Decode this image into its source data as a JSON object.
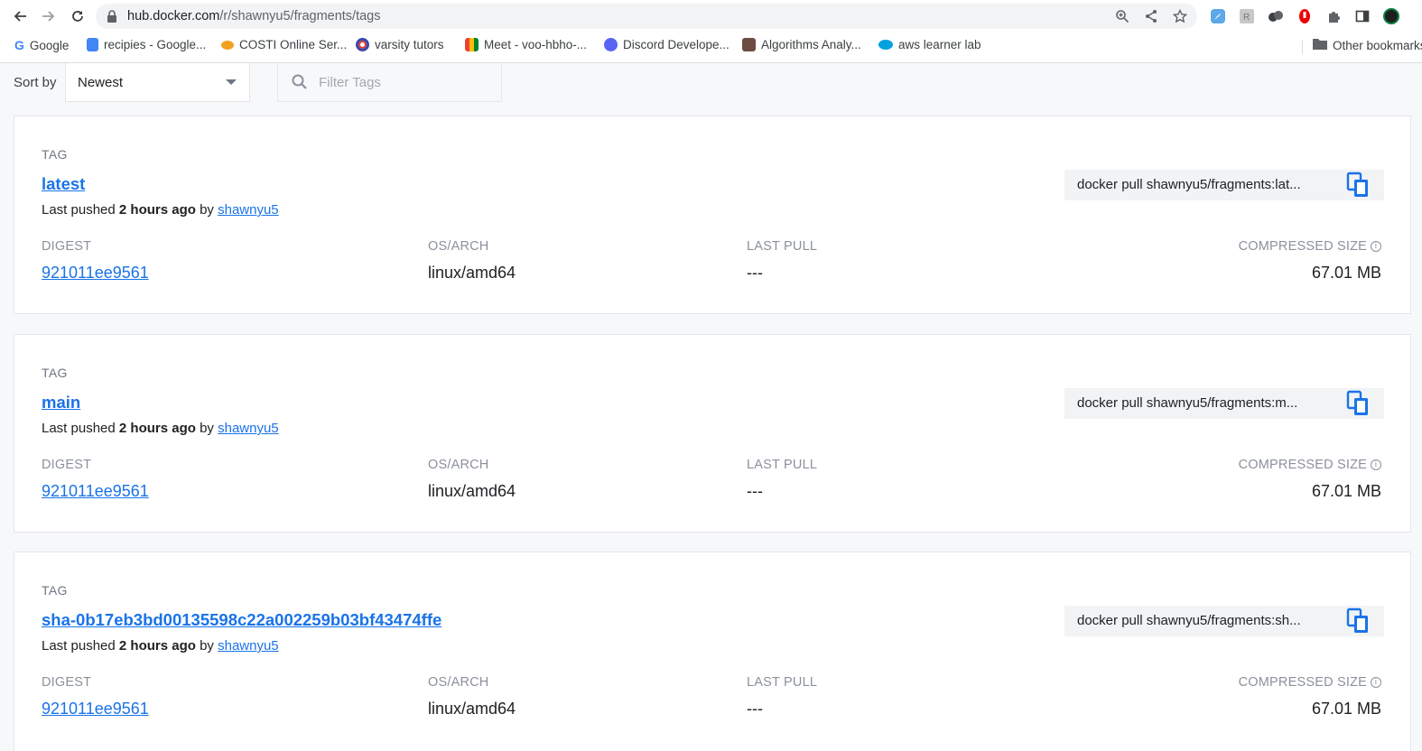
{
  "browser": {
    "url_host": "hub.docker.com",
    "url_path": "/r/shawnyu5/fragments/tags",
    "bookmarks": [
      {
        "label": "Google",
        "color": "#4285f4"
      },
      {
        "label": "recipies - Google...",
        "color": "#4285f4"
      },
      {
        "label": "COSTI Online Ser...",
        "color": "#f4a020"
      },
      {
        "label": "varsity tutors",
        "color": "#e53935"
      },
      {
        "label": "Meet - voo-hbho-...",
        "color": "#00832d"
      },
      {
        "label": "Discord Develope...",
        "color": "#5865f2"
      },
      {
        "label": "Algorithms Analy...",
        "color": "#6d4c41"
      },
      {
        "label": "aws learner lab",
        "color": "#00a1e0"
      }
    ],
    "other_bookmarks": "Other bookmarks"
  },
  "toolbar": {
    "sort_label": "Sort by",
    "sort_value": "Newest",
    "filter_placeholder": "Filter Tags"
  },
  "columns": {
    "tag": "TAG",
    "digest": "DIGEST",
    "os_arch": "OS/ARCH",
    "last_pull": "LAST PULL",
    "compressed_size": "COMPRESSED SIZE"
  },
  "tags": [
    {
      "name": "latest",
      "pushed_prefix": "Last pushed ",
      "pushed_when": "2 hours ago",
      "pushed_by_prefix": " by ",
      "pushed_by": "shawnyu5",
      "pull_command": "docker pull shawnyu5/fragments:lat...",
      "digest": "921011ee9561",
      "os_arch": "linux/amd64",
      "last_pull": "---",
      "size": "67.01 MB"
    },
    {
      "name": "main",
      "pushed_prefix": "Last pushed ",
      "pushed_when": "2 hours ago",
      "pushed_by_prefix": " by ",
      "pushed_by": "shawnyu5",
      "pull_command": "docker pull shawnyu5/fragments:m...",
      "digest": "921011ee9561",
      "os_arch": "linux/amd64",
      "last_pull": "---",
      "size": "67.01 MB"
    },
    {
      "name": "sha-0b17eb3bd00135598c22a002259b03bf43474ffe",
      "pushed_prefix": "Last pushed ",
      "pushed_when": "2 hours ago",
      "pushed_by_prefix": " by ",
      "pushed_by": "shawnyu5",
      "pull_command": "docker pull shawnyu5/fragments:sh...",
      "digest": "921011ee9561",
      "os_arch": "linux/amd64",
      "last_pull": "---",
      "size": "67.01 MB"
    }
  ]
}
